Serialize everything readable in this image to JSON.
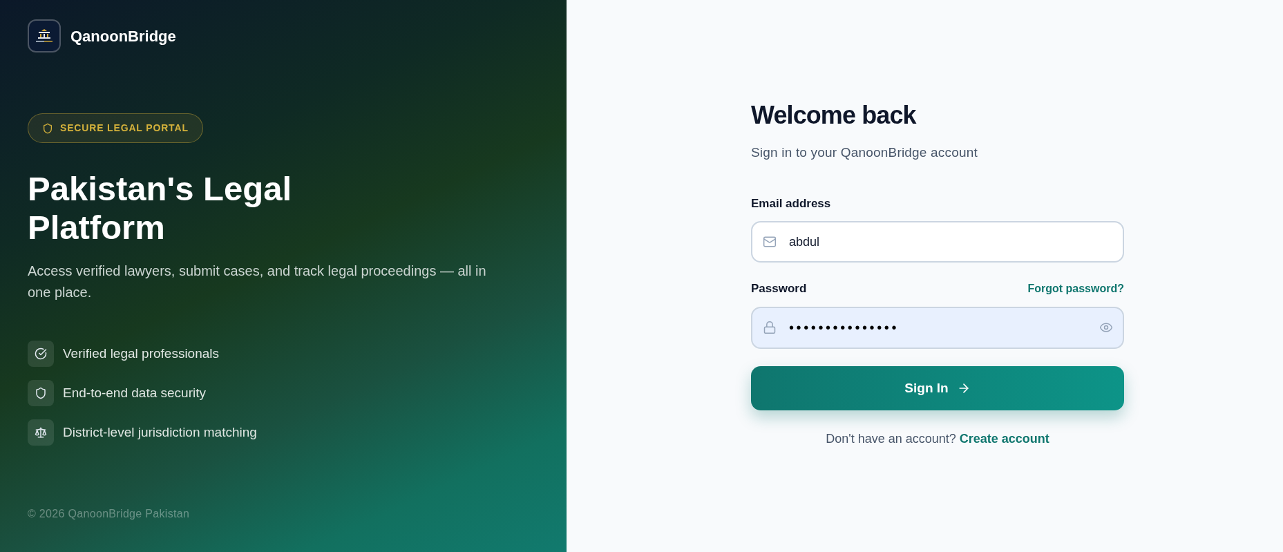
{
  "brand": {
    "name": "QanoonBridge"
  },
  "hero": {
    "badge": "SECURE LEGAL PORTAL",
    "title": "Pakistan's Legal Platform",
    "description": "Access verified lawyers, submit cases, and track legal proceedings — all in one place.",
    "features": [
      {
        "label": "Verified legal professionals"
      },
      {
        "label": "End-to-end data security"
      },
      {
        "label": "District-level jurisdiction matching"
      }
    ]
  },
  "footer": {
    "copyright": "© 2026 QanoonBridge Pakistan"
  },
  "form": {
    "title": "Welcome back",
    "subtitle": "Sign in to your QanoonBridge account",
    "email": {
      "label": "Email address",
      "value": "abdul"
    },
    "password": {
      "label": "Password",
      "value": "•••••••••••••••",
      "autofilled": true
    },
    "forgot_link": "Forgot password?",
    "submit": "Sign In",
    "signup_prompt": "Don't have an account?",
    "signup_link": "Create account"
  }
}
